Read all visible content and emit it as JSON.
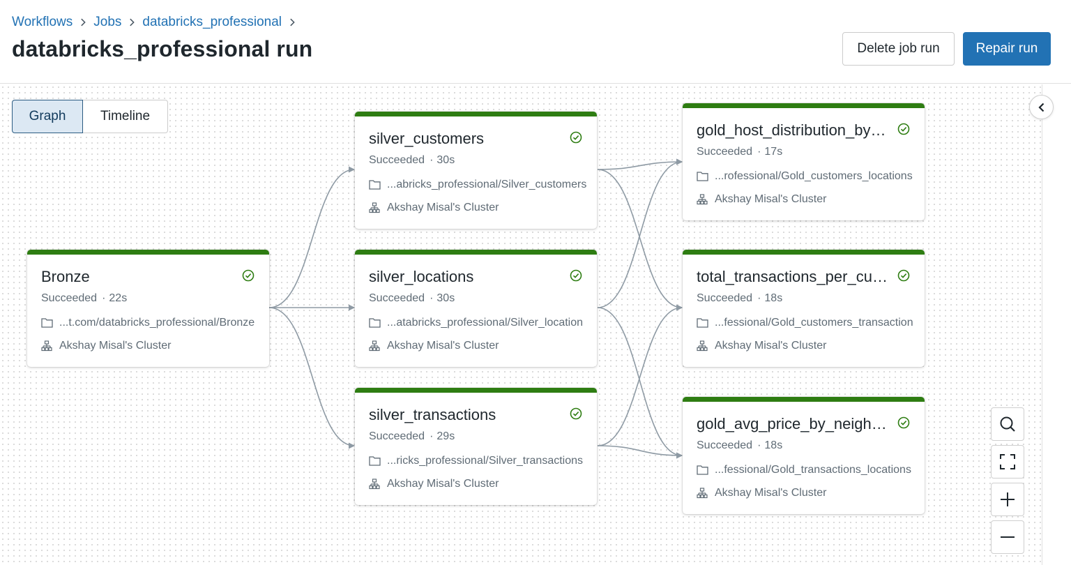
{
  "breadcrumb": {
    "items": [
      "Workflows",
      "Jobs",
      "databricks_professional"
    ]
  },
  "page": {
    "title": "databricks_professional run"
  },
  "actions": {
    "delete_label": "Delete job run",
    "repair_label": "Repair run"
  },
  "view_toggle": {
    "graph_label": "Graph",
    "timeline_label": "Timeline",
    "selected": "Graph"
  },
  "colors": {
    "accent": "#2272b4",
    "success": "#2e7d12",
    "edge": "#8e9aa4"
  },
  "tasks": [
    {
      "name": "Bronze",
      "status": "Succeeded",
      "duration": "22s",
      "path": "...t.com/databricks_professional/Bronze",
      "cluster": "Akshay Misal's Cluster"
    },
    {
      "name": "silver_customers",
      "status": "Succeeded",
      "duration": "30s",
      "path": "...abricks_professional/Silver_customers",
      "cluster": "Akshay Misal's Cluster"
    },
    {
      "name": "silver_locations",
      "status": "Succeeded",
      "duration": "30s",
      "path": "...atabricks_professional/Silver_location",
      "cluster": "Akshay Misal's Cluster"
    },
    {
      "name": "silver_transactions",
      "status": "Succeeded",
      "duration": "29s",
      "path": "...ricks_professional/Silver_transactions",
      "cluster": "Akshay Misal's Cluster"
    },
    {
      "name": "gold_host_distribution_by_…",
      "status": "Succeeded",
      "duration": "17s",
      "path": "...rofessional/Gold_customers_locations",
      "cluster": "Akshay Misal's Cluster"
    },
    {
      "name": "total_transactions_per_cust…",
      "status": "Succeeded",
      "duration": "18s",
      "path": "...fessional/Gold_customers_transaction",
      "cluster": "Akshay Misal's Cluster"
    },
    {
      "name": "gold_avg_price_by_neighbo…",
      "status": "Succeeded",
      "duration": "18s",
      "path": "...fessional/Gold_transactions_locations",
      "cluster": "Akshay Misal's Cluster"
    }
  ],
  "icons": {
    "breadcrumb_separator": "chevron-right-icon",
    "collapse": "chevron-left-icon",
    "status": "check-circle-icon",
    "path": "folder-icon",
    "cluster": "cluster-icon",
    "zoom_search": "search-icon",
    "zoom_fit": "fit-screen-icon",
    "zoom_in": "plus-icon",
    "zoom_out": "minus-icon"
  }
}
